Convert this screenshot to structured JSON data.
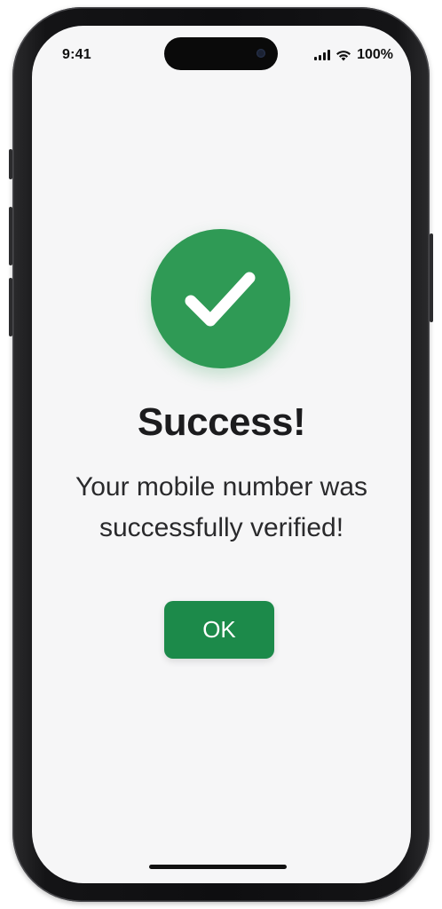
{
  "status_bar": {
    "time": "9:41",
    "battery": "100%",
    "icons": [
      "signal-icon",
      "wifi-icon"
    ]
  },
  "dialog": {
    "icon": "checkmark-icon",
    "title": "Success!",
    "message": "Your mobile number was successfully verified!",
    "ok_label": "OK"
  },
  "colors": {
    "success_green": "#2f9a55",
    "button_green": "#1c8a4a",
    "background": "#f6f6f7"
  }
}
